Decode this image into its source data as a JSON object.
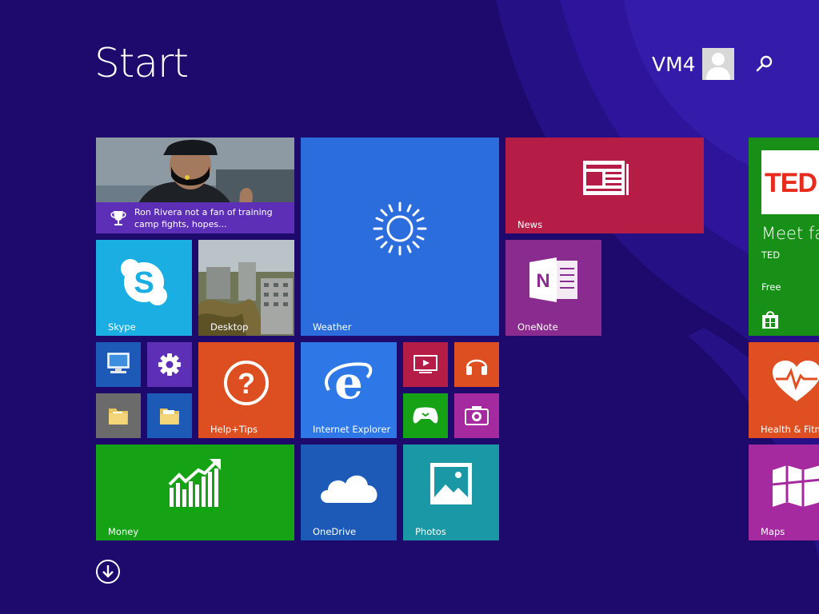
{
  "header": {
    "title": "Start",
    "user_name": "VM4"
  },
  "icons": {
    "search": "search-icon",
    "user": "user-avatar-icon",
    "all_apps": "arrow-down-circle-icon"
  },
  "colors": {
    "background": "#1e0a6c",
    "weather": "#2b6ddd",
    "news": "#b51c46",
    "skype": "#1aaee3",
    "onenote": "#8a2c8f",
    "help": "#dd4e20",
    "internet_explorer": "#2d78e6",
    "money": "#15a315",
    "onedrive": "#1d5ab8",
    "photos": "#1a98a6",
    "store": "#189018",
    "health": "#e04f22",
    "maps": "#a52a9f"
  },
  "tiles": {
    "news_headline": {
      "text": "Ron Rivera not a fan of training camp fights, hopes..."
    },
    "weather": {
      "label": "Weather"
    },
    "news": {
      "label": "News"
    },
    "ted": {
      "title": "Meet fas",
      "publisher": "TED",
      "price": "Free",
      "logo": "TED"
    },
    "skype": {
      "label": "Skype"
    },
    "desktop": {
      "label": "Desktop"
    },
    "onenote": {
      "label": "OneNote"
    },
    "help": {
      "label": "Help+Tips"
    },
    "ie": {
      "label": "Internet Explorer"
    },
    "health": {
      "label": "Health & Fitne"
    },
    "money": {
      "label": "Money"
    },
    "onedrive": {
      "label": "OneDrive"
    },
    "photos": {
      "label": "Photos"
    },
    "maps": {
      "label": "Maps"
    }
  }
}
